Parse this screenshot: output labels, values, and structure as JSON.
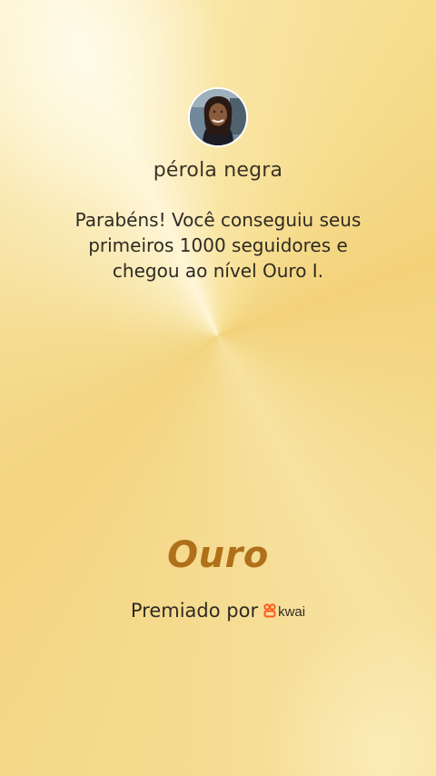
{
  "user": {
    "name": "pérola negra"
  },
  "message": "Parabéns! Você conseguiu seus primeiros 1000 seguidores e chegou ao nível Ouro I.",
  "level": {
    "name": "Ouro"
  },
  "award": {
    "label": "Premiado por",
    "brand": "kwai",
    "brand_icon": "kwai-logo-icon",
    "brand_color": "#ff5a1f"
  },
  "theme": {
    "level_color": "#b0701a"
  }
}
